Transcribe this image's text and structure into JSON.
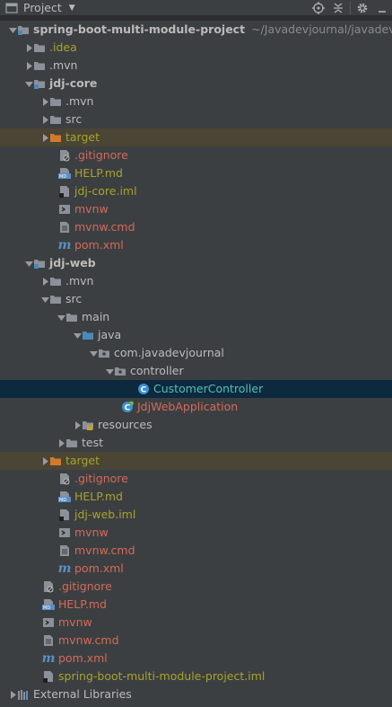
{
  "toolbar": {
    "title": "Project",
    "caret_icon": "caret-down-icon",
    "icons": [
      "target-icon",
      "collapse-icon",
      "gear-icon",
      "hide-icon"
    ]
  },
  "tree": {
    "root_path": "~/Javadevjournal/javadevjo",
    "items": [
      {
        "label": "spring-boot-multi-module-project",
        "icon": "module-folder-icon"
      },
      {
        "label": ".idea",
        "icon": "folder-icon"
      },
      {
        "label": ".mvn",
        "icon": "folder-icon"
      },
      {
        "label": "jdj-core",
        "icon": "module-folder-icon"
      },
      {
        "label": ".mvn",
        "icon": "folder-icon"
      },
      {
        "label": "src",
        "icon": "folder-icon"
      },
      {
        "label": "target",
        "icon": "folder-orange-icon"
      },
      {
        "label": ".gitignore",
        "icon": "gitignore-file-icon"
      },
      {
        "label": "HELP.md",
        "icon": "markdown-file-icon"
      },
      {
        "label": "jdj-core.iml",
        "icon": "iml-file-icon"
      },
      {
        "label": "mvnw",
        "icon": "shell-file-icon"
      },
      {
        "label": "mvnw.cmd",
        "icon": "text-file-icon"
      },
      {
        "label": "pom.xml",
        "icon": "maven-icon"
      },
      {
        "label": "jdj-web",
        "icon": "module-folder-icon"
      },
      {
        "label": ".mvn",
        "icon": "folder-icon"
      },
      {
        "label": "src",
        "icon": "folder-icon"
      },
      {
        "label": "main",
        "icon": "folder-icon"
      },
      {
        "label": "java",
        "icon": "source-folder-icon"
      },
      {
        "label": "com.javadevjournal",
        "icon": "package-icon"
      },
      {
        "label": "controller",
        "icon": "package-icon"
      },
      {
        "label": "CustomerController",
        "icon": "class-icon"
      },
      {
        "label": "JdjWebApplication",
        "icon": "spring-class-icon"
      },
      {
        "label": "resources",
        "icon": "resources-folder-icon"
      },
      {
        "label": "test",
        "icon": "folder-icon"
      },
      {
        "label": "target",
        "icon": "folder-orange-icon"
      },
      {
        "label": ".gitignore",
        "icon": "gitignore-file-icon"
      },
      {
        "label": "HELP.md",
        "icon": "markdown-file-icon"
      },
      {
        "label": "jdj-web.iml",
        "icon": "iml-file-icon"
      },
      {
        "label": "mvnw",
        "icon": "shell-file-icon"
      },
      {
        "label": "mvnw.cmd",
        "icon": "text-file-icon"
      },
      {
        "label": "pom.xml",
        "icon": "maven-icon"
      },
      {
        "label": ".gitignore",
        "icon": "gitignore-file-icon"
      },
      {
        "label": "HELP.md",
        "icon": "markdown-file-icon"
      },
      {
        "label": "mvnw",
        "icon": "shell-file-icon"
      },
      {
        "label": "mvnw.cmd",
        "icon": "text-file-icon"
      },
      {
        "label": "pom.xml",
        "icon": "maven-icon"
      },
      {
        "label": "spring-boot-multi-module-project.iml",
        "icon": "iml-file-icon"
      },
      {
        "label": "External Libraries",
        "icon": "library-icon"
      }
    ]
  },
  "colors": {
    "panel": "#3c3f41",
    "selected": "#0d293e",
    "target_highlight": "#4a4535",
    "ignored_olive": "#a8a32b",
    "unversioned_red": "#d46a5a",
    "modified_teal": "#4ec2b9"
  }
}
